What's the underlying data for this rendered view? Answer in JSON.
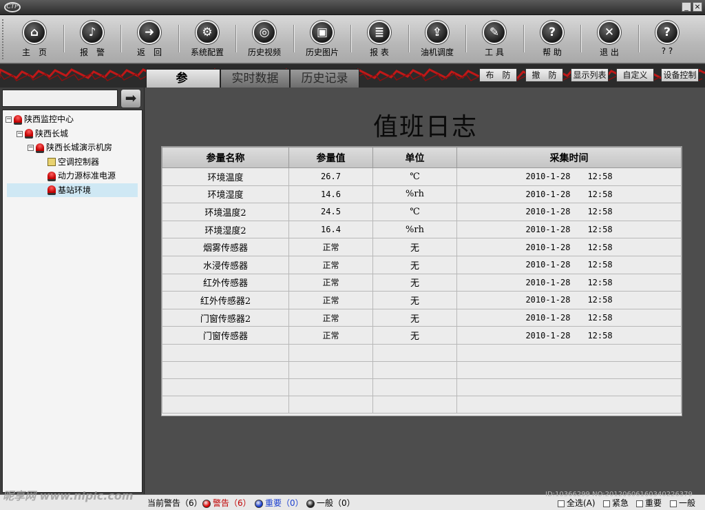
{
  "window": {
    "logo_text": "CTP",
    "minimize": "_",
    "close": "×"
  },
  "toolbar": [
    {
      "label": "主　页",
      "icon": "home-icon",
      "glyph": "⌂"
    },
    {
      "label": "报　警",
      "icon": "bell-icon",
      "glyph": "♪"
    },
    {
      "label": "返　回",
      "icon": "arrow-right-icon",
      "glyph": "➜"
    },
    {
      "label": "系统配置",
      "icon": "gears-icon",
      "glyph": "⚙"
    },
    {
      "label": "历史视频",
      "icon": "film-reel-icon",
      "glyph": "◎"
    },
    {
      "label": "历史图片",
      "icon": "picture-icon",
      "glyph": "▣"
    },
    {
      "label": "报 表",
      "icon": "report-icon",
      "glyph": "≣"
    },
    {
      "label": "油机调度",
      "icon": "generator-icon",
      "glyph": "⇪"
    },
    {
      "label": "工 具",
      "icon": "wrench-icon",
      "glyph": "✎"
    },
    {
      "label": "帮 助",
      "icon": "help-icon",
      "glyph": "?"
    },
    {
      "label": "退 出",
      "icon": "exit-icon",
      "glyph": "✕"
    },
    {
      "label": "? ?",
      "icon": "question-icon",
      "glyph": "?"
    }
  ],
  "tabs": [
    {
      "label": "参 数",
      "active": true
    },
    {
      "label": "实时数据",
      "active": false
    },
    {
      "label": "历史记录",
      "active": false
    }
  ],
  "controls": [
    "布　防",
    "撤　防",
    "显示列表",
    "自定义",
    "设备控制"
  ],
  "search": {
    "placeholder": "",
    "go_glyph": "➡"
  },
  "tree": [
    {
      "label": "陕西监控中心",
      "level": 0,
      "expander": "−",
      "icon": "alarm-light-icon"
    },
    {
      "label": "陕西长城",
      "level": 1,
      "expander": "−",
      "icon": "alarm-light-icon"
    },
    {
      "label": "陕西长城演示机房",
      "level": 2,
      "expander": "−",
      "icon": "alarm-light-icon"
    },
    {
      "label": "空调控制器",
      "level": 3,
      "expander": "",
      "icon": "air-conditioner-icon"
    },
    {
      "label": "动力源标准电源",
      "level": 3,
      "expander": "",
      "icon": "alarm-light-icon"
    },
    {
      "label": "基站环境",
      "level": 3,
      "expander": "",
      "icon": "alarm-light-icon",
      "selected": true
    }
  ],
  "log": {
    "title": "值班日志",
    "columns": [
      "参量名称",
      "参量值",
      "单位",
      "采集时间"
    ],
    "rows": [
      {
        "name": "环境温度",
        "value": "26.7",
        "unit": "℃",
        "date": "2010-1-28",
        "time": "12:58"
      },
      {
        "name": "环境湿度",
        "value": "14.6",
        "unit": "%rh",
        "date": "2010-1-28",
        "time": "12:58"
      },
      {
        "name": "环境温度2",
        "value": "24.5",
        "unit": "℃",
        "date": "2010-1-28",
        "time": "12:58"
      },
      {
        "name": "环境湿度2",
        "value": "16.4",
        "unit": "%rh",
        "date": "2010-1-28",
        "time": "12:58"
      },
      {
        "name": "烟雾传感器",
        "value": "正常",
        "unit": "无",
        "date": "2010-1-28",
        "time": "12:58"
      },
      {
        "name": "水浸传感器",
        "value": "正常",
        "unit": "无",
        "date": "2010-1-28",
        "time": "12:58"
      },
      {
        "name": "红外传感器",
        "value": "正常",
        "unit": "无",
        "date": "2010-1-28",
        "time": "12:58"
      },
      {
        "name": "红外传感器2",
        "value": "正常",
        "unit": "无",
        "date": "2010-1-28",
        "time": "12:58"
      },
      {
        "name": "门窗传感器2",
        "value": "正常",
        "unit": "无",
        "date": "2010-1-28",
        "time": "12:58"
      },
      {
        "name": "门窗传感器",
        "value": "正常",
        "unit": "无",
        "date": "2010-1-28",
        "time": "12:58"
      }
    ],
    "empty_rows": 4
  },
  "status": {
    "current": "当前警告（6）",
    "items": [
      {
        "label": "警告（6）",
        "color": "#e00000"
      },
      {
        "label": "重要（0）",
        "color": "#1a3fd0"
      },
      {
        "label": "一般（0）",
        "color": "#222222"
      }
    ],
    "filters": [
      "全选(A)",
      "紧急",
      "重要",
      "一般"
    ]
  },
  "watermarks": {
    "left": "昵享网 www.nipic.com",
    "right": "ID:10366299 NO:20120606160340226379"
  },
  "colors": {
    "stripe": "#c01818",
    "alarm": "#e00000"
  }
}
